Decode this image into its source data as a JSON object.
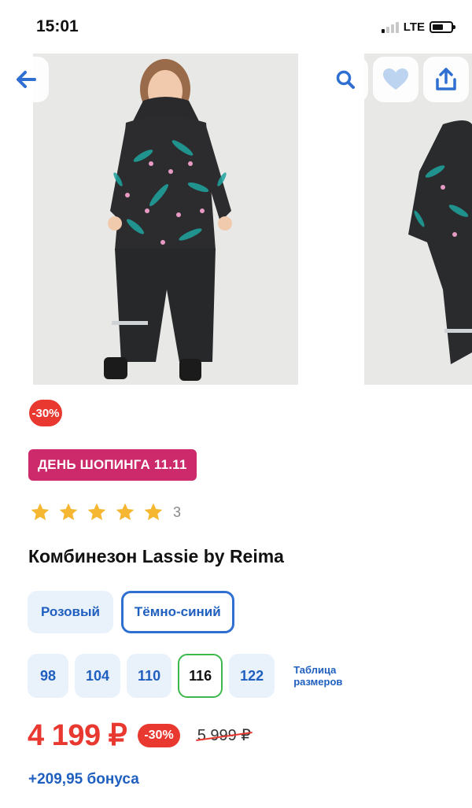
{
  "status_bar": {
    "time": "15:01",
    "network": "LTE"
  },
  "gallery": {
    "icons": {
      "back": "arrow-left-icon",
      "search": "search-icon",
      "favorite": "heart-icon",
      "share": "share-icon"
    },
    "accent": "#2f6fd1"
  },
  "badges": {
    "discount": "-30%",
    "promo": "ДЕНЬ ШОПИНГА 11.11"
  },
  "rating": {
    "stars": 5,
    "count": "3"
  },
  "product": {
    "title": "Комбинезон Lassie by Reima"
  },
  "colors": [
    {
      "label": "Розовый",
      "selected": false
    },
    {
      "label": "Тёмно-синий",
      "selected": true
    }
  ],
  "sizes": [
    {
      "label": "98",
      "selected": false
    },
    {
      "label": "104",
      "selected": false
    },
    {
      "label": "110",
      "selected": false
    },
    {
      "label": "116",
      "selected": true
    },
    {
      "label": "122",
      "selected": false
    }
  ],
  "size_table_link": "Таблица размеров",
  "price": {
    "current": "4 199 ₽",
    "discount": "-30%",
    "old": "5 999 ₽"
  },
  "bonus": "+209,95 бонуса",
  "colors_palette": {
    "red": "#e8382f",
    "promo": "#cc2a6b",
    "blue": "#1f5fbf",
    "star": "#f5b731"
  }
}
